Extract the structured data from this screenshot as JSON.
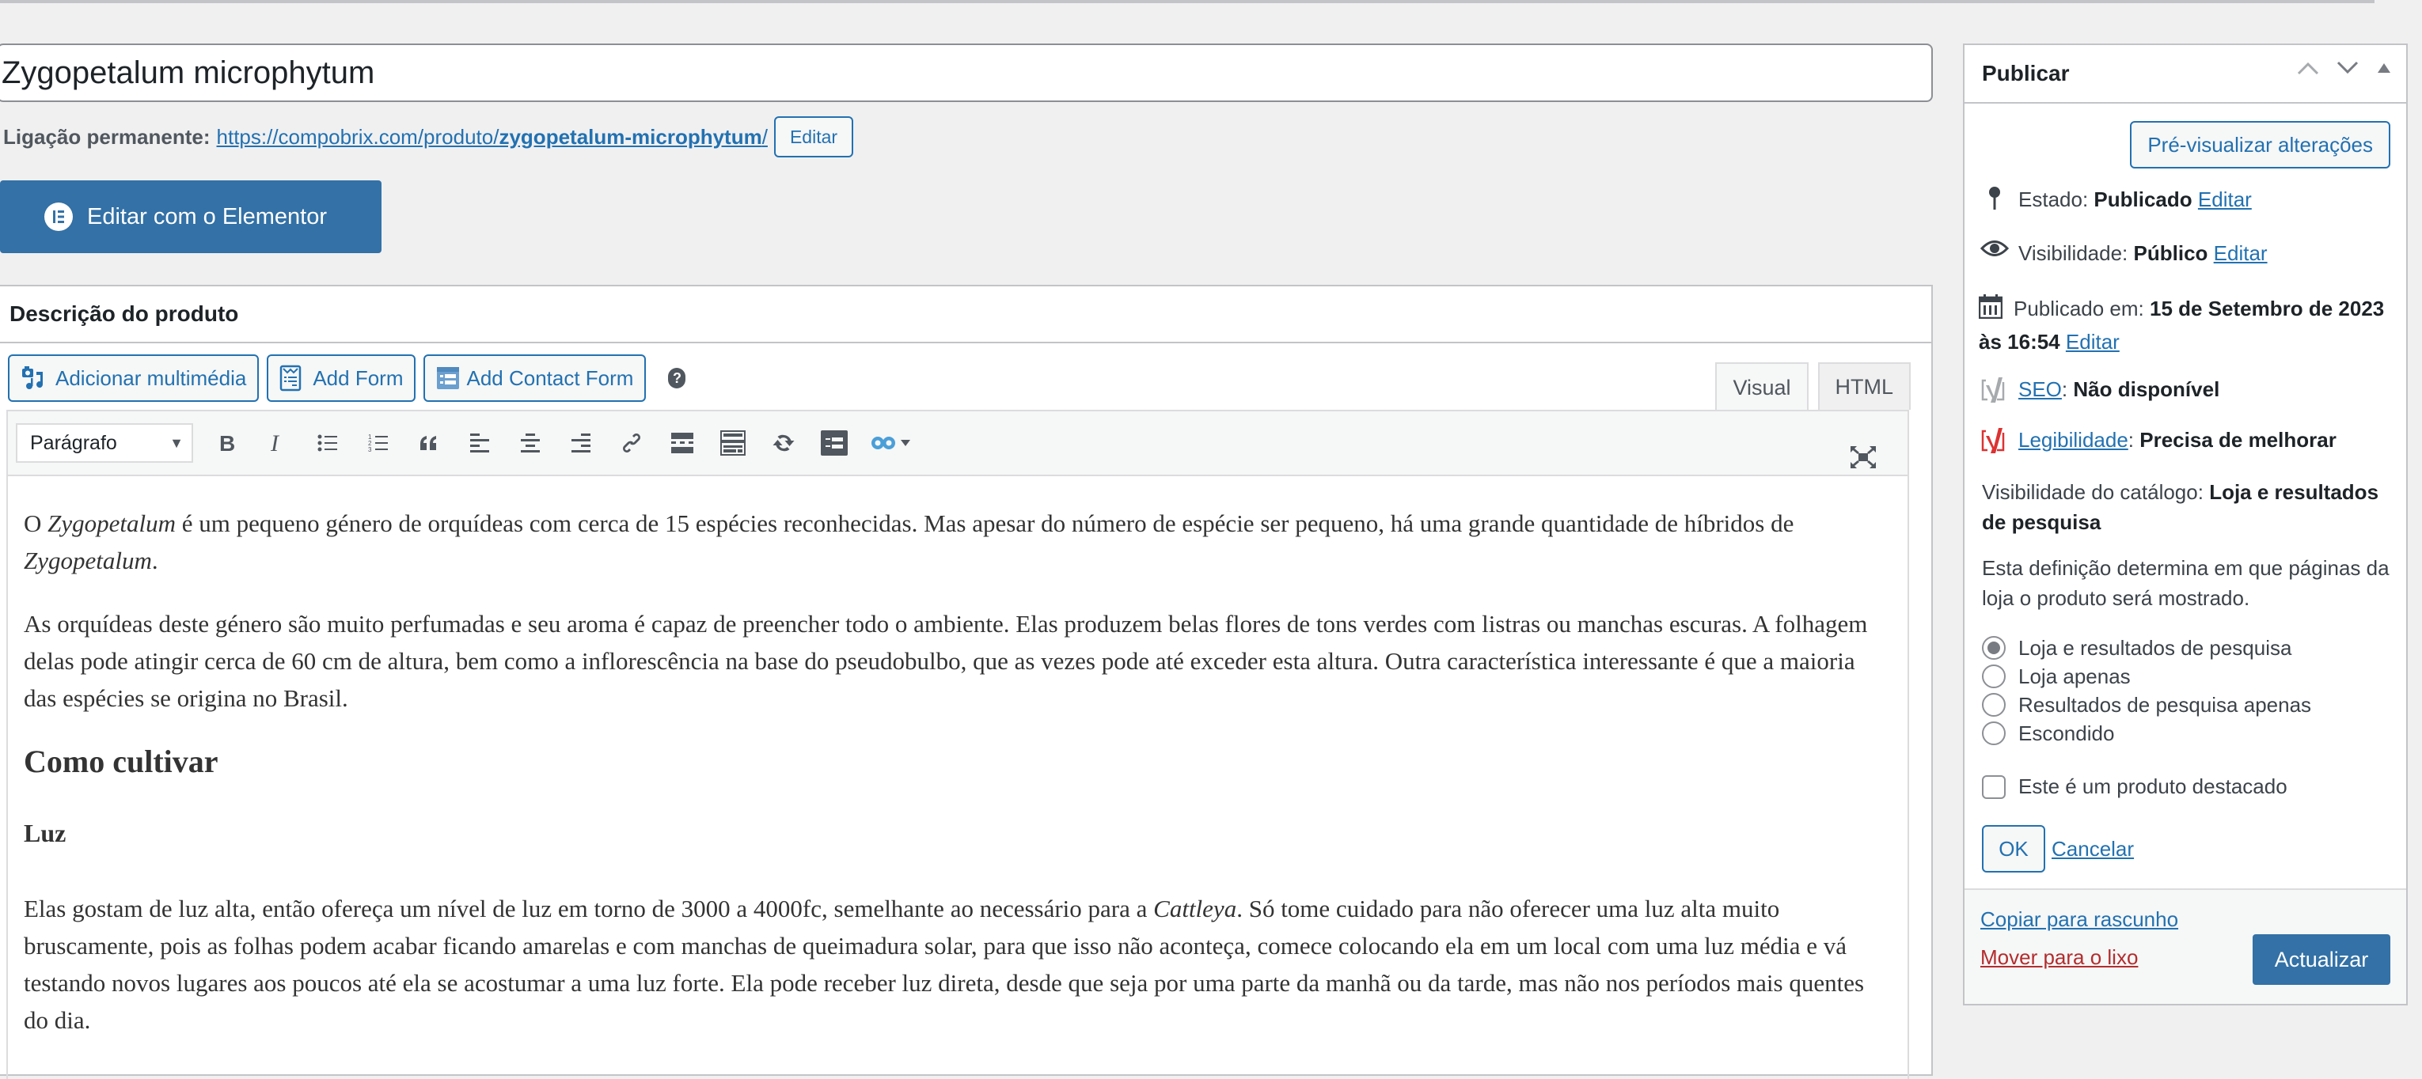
{
  "title": {
    "value": "Zygopetalum microphytum"
  },
  "permalink": {
    "label": "Ligação permanente:",
    "url_prefix": "https://compobrix.com/produto/",
    "slug": "zygopetalum-microphytum",
    "url_suffix": "/",
    "edit_label": "Editar"
  },
  "elementor": {
    "label": "Editar com o Elementor",
    "icon": "elementor-icon"
  },
  "postbox": {
    "title": "Descrição do produto",
    "media_buttons": [
      {
        "label": "Adicionar multimédia",
        "icon": "add-media-icon"
      },
      {
        "label": "Add Form",
        "icon": "form-icon"
      },
      {
        "label": "Add Contact Form",
        "icon": "contact-form-icon"
      }
    ],
    "help": "?",
    "tabs": [
      {
        "label": "Visual",
        "active": true
      },
      {
        "label": "HTML",
        "active": false
      }
    ],
    "toolbar": {
      "format_value": "Parágrafo",
      "buttons": [
        "bold",
        "italic",
        "bulleted-list",
        "numbered-list",
        "blockquote",
        "align-left",
        "align-center",
        "align-right",
        "insert-link",
        "read-more",
        "toolbar-toggle",
        "refresh",
        "form-insert",
        "infinity-plugin"
      ]
    }
  },
  "content": {
    "p1": {
      "a": "O ",
      "i1": "Zygopetalum",
      "b": " é um pequeno género de orquídeas com cerca de 15 espécies reconhecidas. Mas apesar do número de espécie ser pequeno, há uma grande quantidade de híbridos de ",
      "i2": "Zygopetalum",
      "c": "."
    },
    "p2": "As orquídeas deste género são muito perfumadas e seu aroma é capaz de preencher todo o ambiente. Elas produzem belas flores de tons verdes com listras ou manchas escuras. A folhagem delas pode atingir cerca de 60 cm de altura, bem como a inflorescência na base do pseudobulbo, que as vezes pode até exceder esta altura. Outra característica interessante é que a maioria das espécies se origina no Brasil.",
    "h2": "Como cultivar",
    "h3": "Luz",
    "p3": {
      "a": "Elas gostam de luz alta, então ofereça um nível de luz em torno de 3000 a 4000fc, semelhante ao necessário para a ",
      "i1": "Cattleya",
      "b": ". Só tome cuidado para não oferecer uma luz alta muito bruscamente, pois as folhas podem acabar ficando amarelas e com manchas de queimadura solar, para que isso não aconteça, comece colocando ela em um local com uma luz média e vá testando novos lugares aos poucos até ela se acostumar a uma luz forte. Ela pode receber luz direta, desde que seja por uma parte da manhã ou da tarde, mas não nos períodos mais quentes do dia."
    }
  },
  "publish": {
    "title": "Publicar",
    "preview_label": "Pré-visualizar alterações",
    "status": {
      "label": "Estado:",
      "value": "Publicado",
      "edit": "Editar"
    },
    "visibility": {
      "label": "Visibilidade:",
      "value": "Público",
      "edit": "Editar"
    },
    "published": {
      "label": "Publicado em:",
      "value": "15 de Setembro de 2023 às 16:54",
      "edit": "Editar"
    },
    "seo": {
      "label": "SEO",
      "value": "Não disponível",
      "color": "#a7aaad"
    },
    "readability": {
      "label": "Legibilidade",
      "value": "Precisa de melhorar",
      "color": "#dc3232"
    },
    "catalog": {
      "label": "Visibilidade do catálogo:",
      "value": "Loja e resultados de pesquisa"
    },
    "catalog_help": "Esta definição determina em que páginas da loja o produto será mostrado.",
    "catalog_options": [
      {
        "label": "Loja e resultados de pesquisa",
        "checked": true
      },
      {
        "label": "Loja apenas",
        "checked": false
      },
      {
        "label": "Resultados de pesquisa apenas",
        "checked": false
      },
      {
        "label": "Escondido",
        "checked": false
      }
    ],
    "featured": {
      "label": "Este é um produto destacado",
      "checked": false
    },
    "ok_label": "OK",
    "cancel_label": "Cancelar",
    "copy_draft_label": "Copiar para rascunho",
    "trash_label": "Mover para o lixo",
    "update_label": "Actualizar"
  },
  "colors": {
    "primary": "#2271b1",
    "button_bg": "#3371a6",
    "danger": "#b32d2e",
    "background": "#f0f0f1"
  }
}
